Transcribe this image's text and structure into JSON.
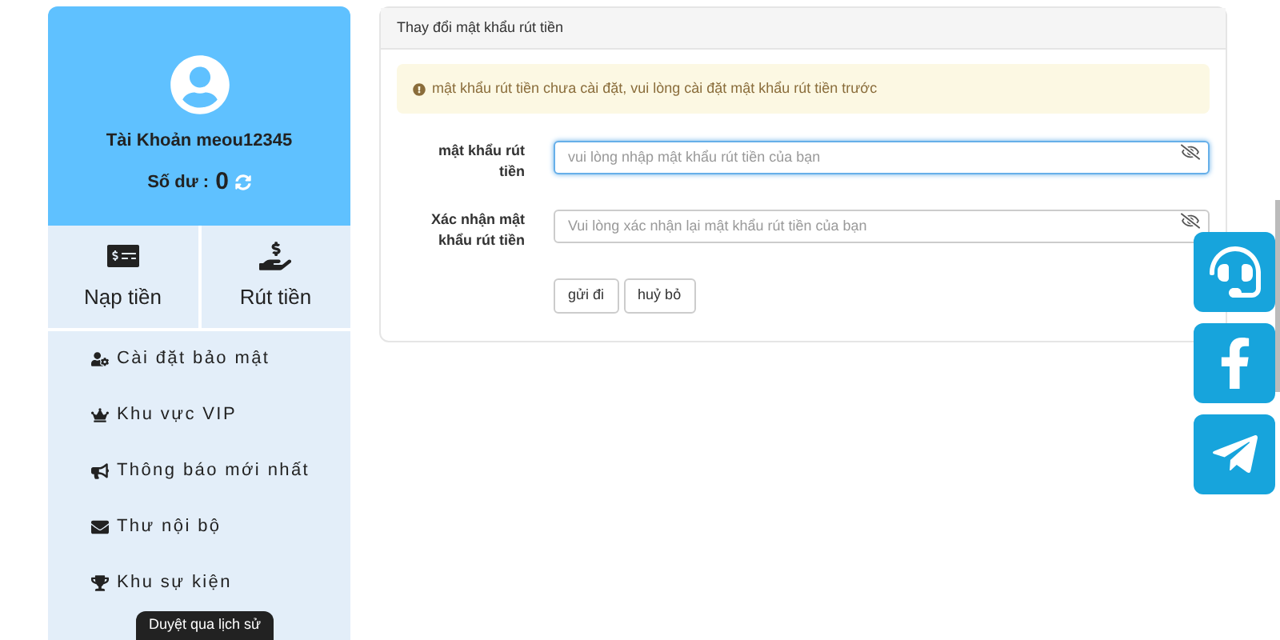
{
  "profile": {
    "account": "Tài Khoản meou12345",
    "balance_label": "Số dư :",
    "balance": "0"
  },
  "actions": [
    {
      "kind": "deposit",
      "label": "Nạp tiền"
    },
    {
      "kind": "withdraw",
      "label": "Rút tiền"
    }
  ],
  "menu": [
    {
      "kind": "security",
      "label": "Cài đặt bảo mật"
    },
    {
      "kind": "vip",
      "label": "Khu vực VIP"
    },
    {
      "kind": "news",
      "label": "Thông báo mới nhất"
    },
    {
      "kind": "mail",
      "label": "Thư nội bộ"
    },
    {
      "kind": "event",
      "label": "Khu sự kiện"
    }
  ],
  "tooltip": "Duyệt qua lịch sử",
  "panel": {
    "title": "Thay đổi mật khẩu rút tiền",
    "alert": "mật khẩu rút tiền chưa cài đặt, vui lòng cài đặt mật khẩu rút tiền trước",
    "fields": [
      {
        "label": "mật khẩu rút tiền",
        "placeholder": "vui lòng nhập mật khẩu rút tiền của bạn",
        "focused": true
      },
      {
        "label": "Xác nhận mật khẩu rút tiền",
        "placeholder": "Vui lòng xác nhận lại mật khẩu rút tiền của bạn",
        "focused": false
      }
    ],
    "buttons": [
      "gửi đi",
      "huỷ bỏ"
    ]
  },
  "floating": [
    {
      "kind": "support"
    },
    {
      "kind": "facebook"
    },
    {
      "kind": "telegram"
    }
  ]
}
